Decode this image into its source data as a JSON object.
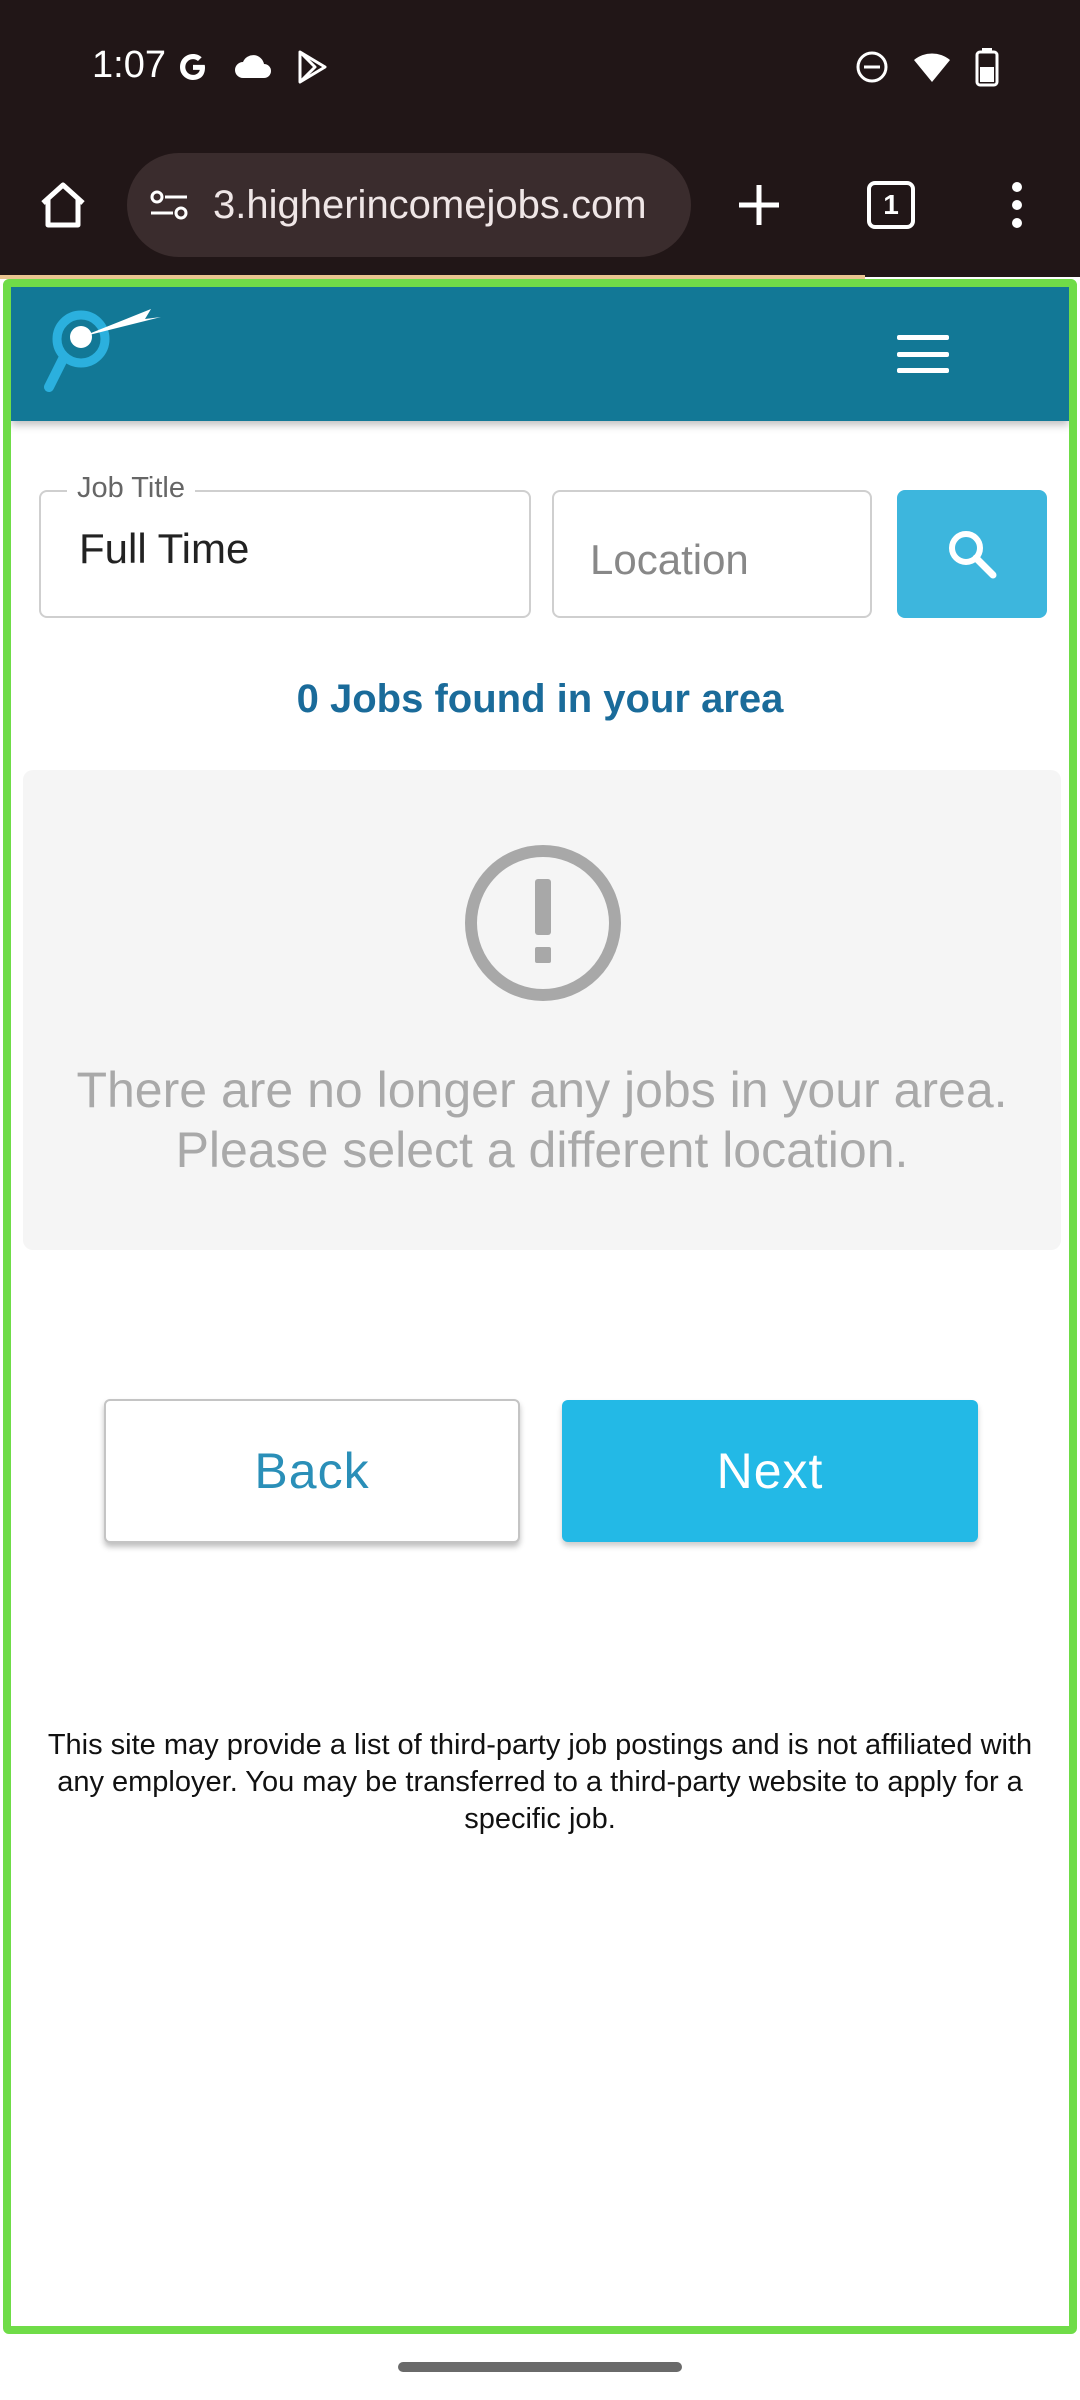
{
  "status_bar": {
    "time": "1:07",
    "left_icons": [
      "google-icon",
      "cloud-icon",
      "play-store-icon"
    ],
    "right_icons": [
      "do-not-disturb-icon",
      "wifi-icon",
      "battery-icon"
    ]
  },
  "browser": {
    "url": "3.higherincomejobs.com",
    "tab_count": "1"
  },
  "site": {
    "search": {
      "job_title_label": "Job Title",
      "job_title_value": "Full Time",
      "location_placeholder": "Location"
    },
    "jobs_found": "0 Jobs found in your area",
    "empty_message": "There are no longer any jobs in your area. Please select a different location.",
    "back_label": "Back",
    "next_label": "Next",
    "disclaimer": "This site may provide a list of third-party job postings and is not affiliated with any employer. You may be transferred to a third-party website to apply for a specific job."
  },
  "colors": {
    "header": "#127896",
    "search_button": "#3db6dd",
    "next_button": "#23b9e6",
    "jobs_found_text": "#1a6b9a",
    "frame_highlight": "#6fdc48"
  }
}
